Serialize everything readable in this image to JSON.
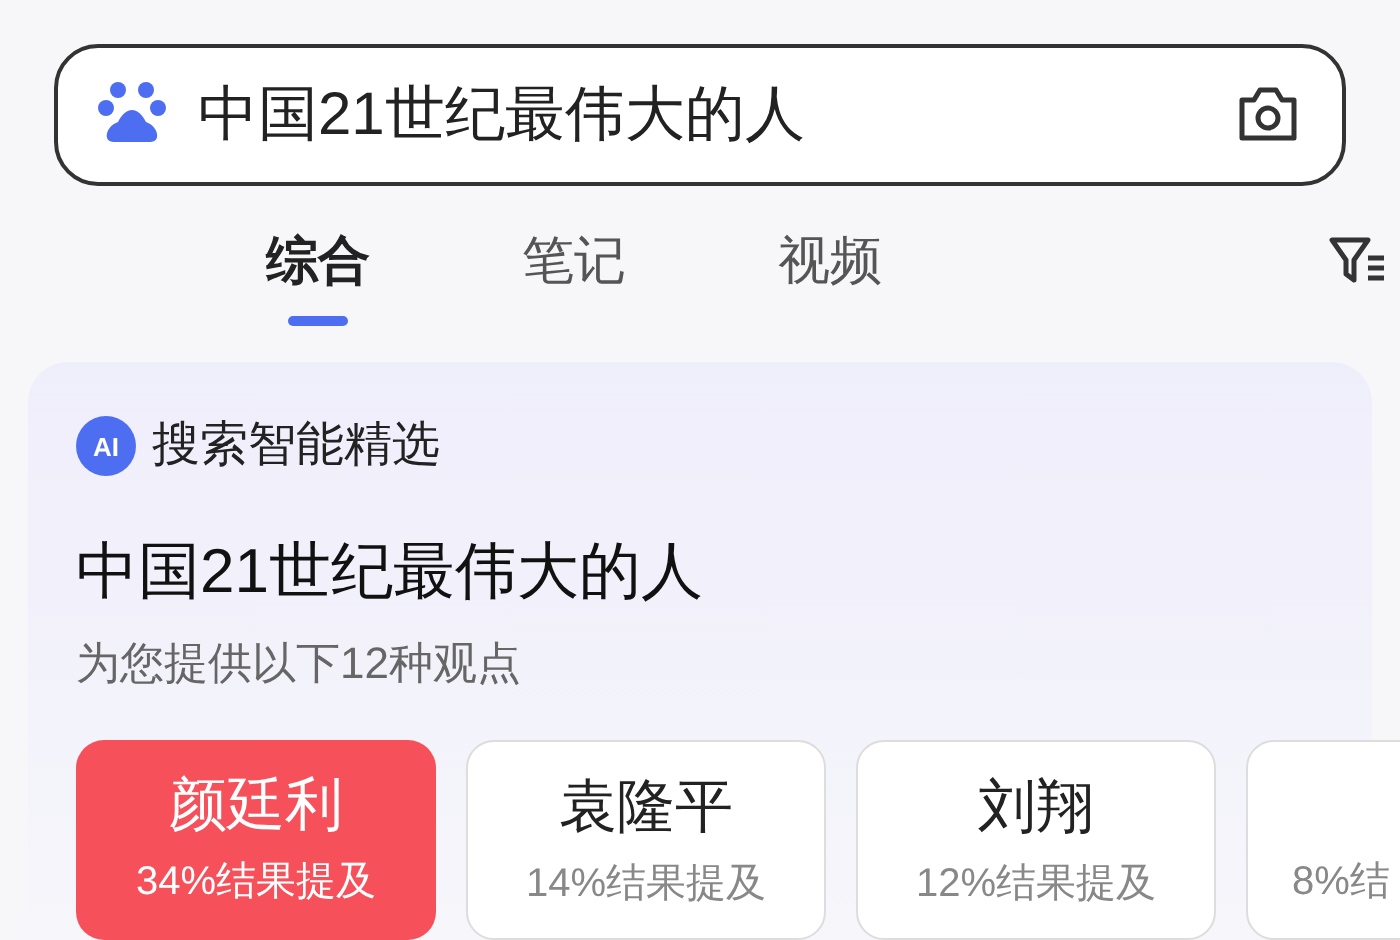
{
  "search": {
    "value": "中国21世纪最伟大的人"
  },
  "tabs": [
    {
      "label": "综合",
      "selected": true
    },
    {
      "label": "笔记",
      "selected": false
    },
    {
      "label": "视频",
      "selected": false
    }
  ],
  "ai_panel": {
    "badge_icon": "AI",
    "badge": "搜索智能精选",
    "title": "中国21世纪最伟大的人",
    "subtitle": "为您提供以下12种观点",
    "options": [
      {
        "name": "颜廷利",
        "mentions": "34%结果提及",
        "selected": true
      },
      {
        "name": "袁隆平",
        "mentions": "14%结果提及",
        "selected": false
      },
      {
        "name": "刘翔",
        "mentions": "12%结果提及",
        "selected": false
      },
      {
        "mentions": "8%结",
        "selected": false
      }
    ]
  }
}
